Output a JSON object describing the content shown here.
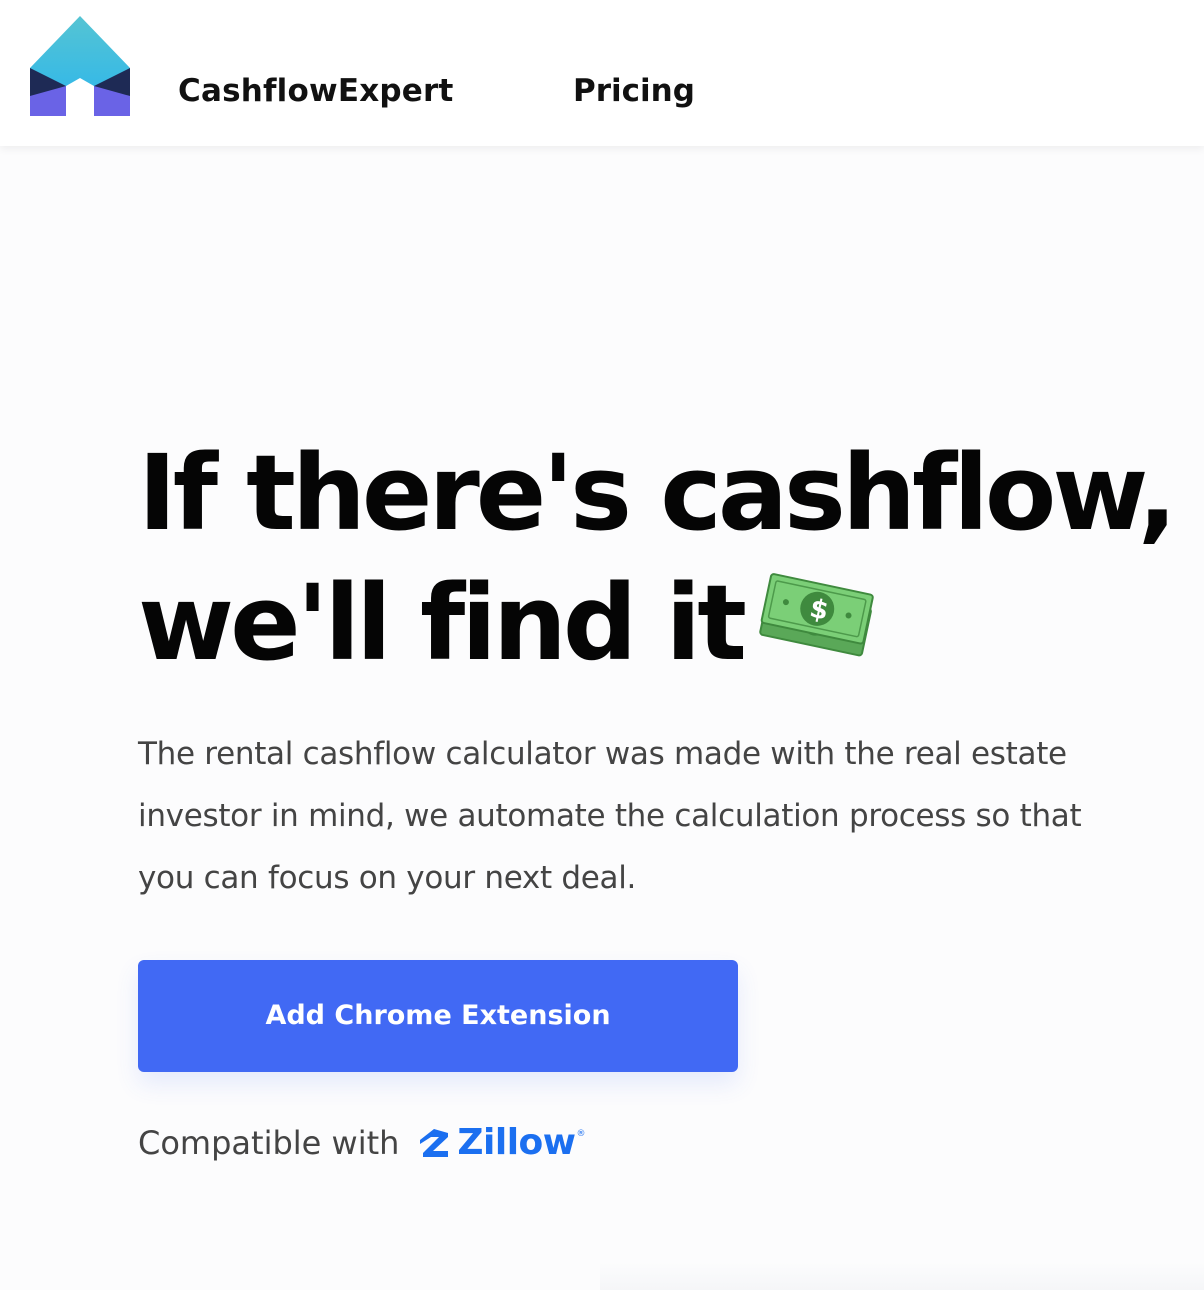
{
  "nav": {
    "brand": "CashflowExpert",
    "pricing_label": "Pricing",
    "logo_icon": "house-logo-icon"
  },
  "hero": {
    "title_line1": "If there's cashflow,",
    "title_line2": "we'll find it",
    "title_emoji": "money-with-wings-icon",
    "description": "The rental cashflow calculator was made with the real estate investor in mind, we automate the calculation process so that you can focus on your next deal.",
    "cta_label": "Add Chrome Extension",
    "compat_label": "Compatible with",
    "partner_name": "Zillow",
    "partner_reg": "®"
  },
  "colors": {
    "accent": "#4169f4",
    "zillow_blue": "#1b6ff0",
    "logo_teal": "#4bc6d6",
    "logo_navy": "#1e2a55",
    "logo_violet": "#6d5fe8",
    "money_green": "#6ec26b"
  }
}
